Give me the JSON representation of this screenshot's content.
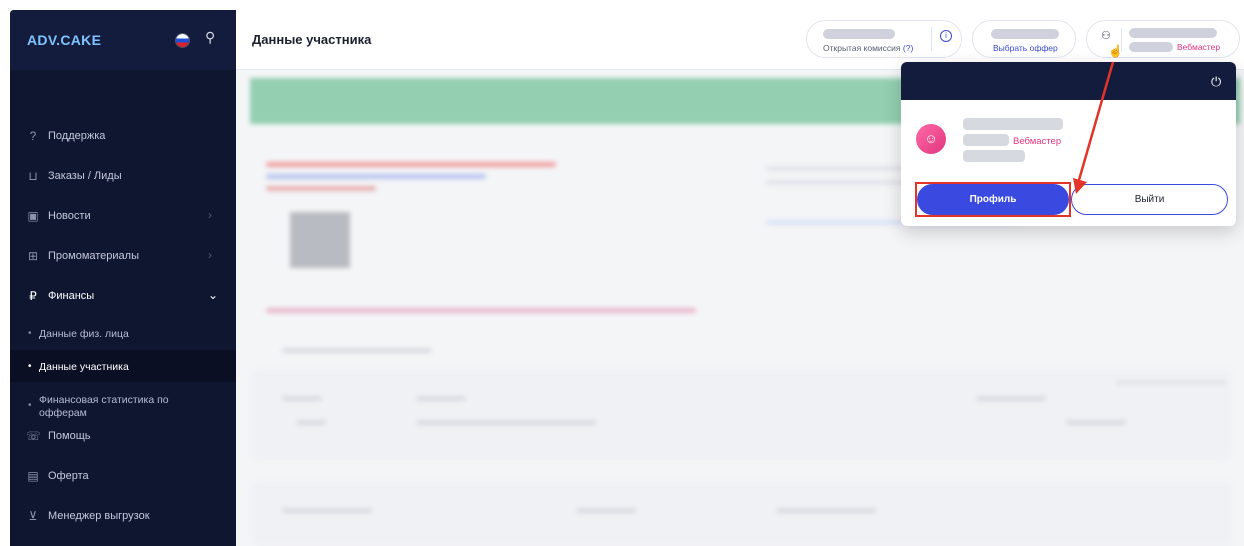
{
  "sidebar": {
    "logo": "ADV.CAKE",
    "items": [
      {
        "label": "Поддержка",
        "icon": "help-icon"
      },
      {
        "label": "Заказы / Лиды",
        "icon": "cart-icon"
      },
      {
        "label": "Новости",
        "icon": "rss-icon",
        "chevron": "›"
      },
      {
        "label": "Промоматериалы",
        "icon": "gift-icon",
        "chevron": "›"
      },
      {
        "label": "Финансы",
        "icon": "ruble-icon",
        "chevron": "⌄"
      },
      {
        "label": "Помощь",
        "icon": "chat-icon"
      },
      {
        "label": "Оферта",
        "icon": "document-icon"
      },
      {
        "label": "Менеджер выгрузок",
        "icon": "download-icon"
      }
    ],
    "sub_items": [
      {
        "label": "Данные физ. лица"
      },
      {
        "label": "Данные участника"
      },
      {
        "label": "Финансовая статистика по офферам"
      }
    ]
  },
  "header": {
    "title": "Данные участника",
    "commission_label": "Открытая комиссия",
    "commission_hint": "(?)",
    "offer_label": "Выбрать оффер",
    "role": "Вебмастер"
  },
  "profile_menu": {
    "role": "Вебмастер",
    "profile_button": "Профиль",
    "logout_button": "Выйти"
  },
  "colors": {
    "sidebar_bg": "#0f1630",
    "accent_blue": "#3a4ae0",
    "accent_pink": "#e0357e",
    "annotation_red": "#e3342a"
  }
}
